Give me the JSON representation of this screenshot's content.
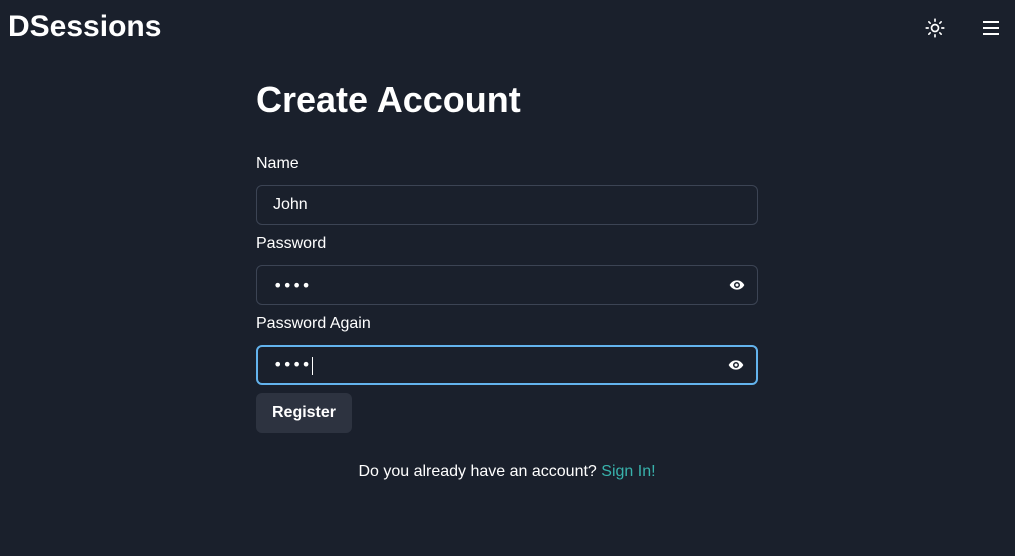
{
  "header": {
    "brand": "DSessions",
    "theme_toggle_icon": "sun-icon",
    "menu_icon": "hamburger-menu-icon"
  },
  "form": {
    "title": "Create Account",
    "name_label": "Name",
    "name_value": "John",
    "password_label": "Password",
    "password_value": "••••",
    "password_again_label": "Password Again",
    "password_again_value": "••••",
    "show_password_icon": "eye-icon",
    "register_label": "Register"
  },
  "footer": {
    "prompt": "Do you already have an account?",
    "signin_link": "Sign In!"
  },
  "colors": {
    "background": "#1a202c",
    "focus_border": "#63b3ed",
    "link": "#38b2ac",
    "button_bg": "#2d3340"
  }
}
